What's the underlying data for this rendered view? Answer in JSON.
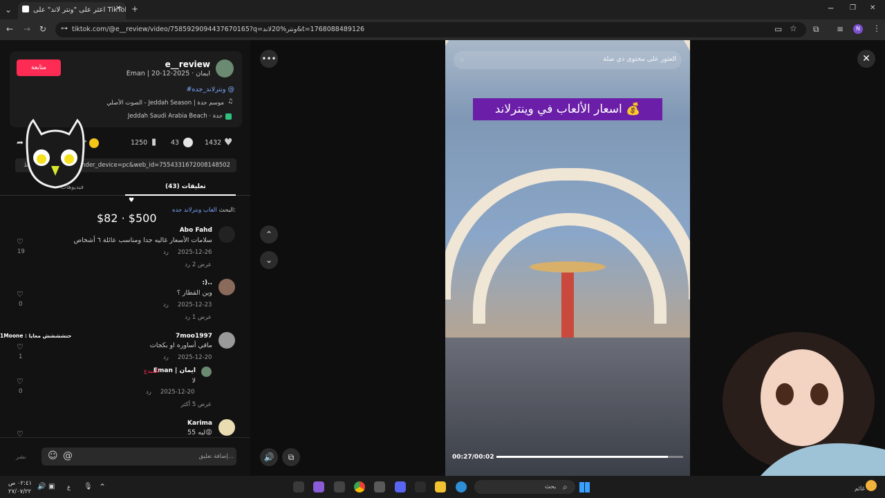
{
  "browser": {
    "tab_title": "اعثر على \"ونتر لاند\" على TikTok",
    "new_tab": "+",
    "url": "tiktok.com/@e__review/video/7585929094437670165?q=ونتر%20لاند&t=1768088489126",
    "profile_initial": "N"
  },
  "author": {
    "username": "e__review",
    "meta": "Eman | ايمان · 2025-12-20",
    "follow_label": "متابعة",
    "hashtag": "#ونترلاند_جده @",
    "music": "الصوت الأصلي - Jeddah Season | موسم جدة",
    "location": "Jeddah Saudi Arabia Beach · جدة"
  },
  "stats": {
    "likes": "1432",
    "comments": "43",
    "saves": "1250"
  },
  "share_link": "p?sender_device=pc&web_id=7554331672008148502",
  "copy_label": "نسخ الرابط",
  "tabs": {
    "comments": "(43) تعليقات",
    "videos": "فيديوهات"
  },
  "search_suggestion": {
    "prefix": "البحث:",
    "query": "العاب ونترلاند جده"
  },
  "price_overlay": "$82 · $500",
  "comments": [
    {
      "name": "Abo Fahd",
      "text": "سلامات الأسعار غاليه جدا ومناسب عائلة ٦ أشخاص",
      "date": "2025-12-26",
      "reply": "رد",
      "likes": "19",
      "view_replies": "عرض 2 رد"
    },
    {
      "name": ":)..",
      "text": "وين القطار ؟",
      "date": "2025-12-23",
      "reply": "رد",
      "likes": "0",
      "view_replies": "عرض 1 رد"
    },
    {
      "name": "7moo1997",
      "text": "ماقي أساوره او بكجات",
      "date": "2025-12-20",
      "reply": "رد",
      "likes": "1"
    },
    {
      "name": "Eman | ايمان",
      "badge": "المبدع",
      "text": "لا",
      "date": "2025-12-20",
      "reply": "رد",
      "likes": "0",
      "view_replies": "عرض 5 أكثر"
    },
    {
      "name": "Karima",
      "text": "55 ليه😡",
      "likes": ""
    }
  ],
  "chat_overlay": "1Moone : حتشششش معايا",
  "comment_input": {
    "placeholder": "إضافة تعليق...",
    "post_label": "نشر"
  },
  "video": {
    "search_placeholder": "العثور على محتوى ذي صلة",
    "caption": "اسعار الألعاب في وينترلاند 💰",
    "time": "00:27/00:02",
    "progress": 0.92
  },
  "taskbar": {
    "search_label": "بحث",
    "clock_time": "٠٢:٤١ ص",
    "clock_date": "٢٧/٠٧/٢٢",
    "lang": "ع",
    "weather": "غائم"
  },
  "colors": {
    "accent": "#fe2c55",
    "link": "#7ea8ff",
    "caption_bg": "#6b1fa8"
  }
}
